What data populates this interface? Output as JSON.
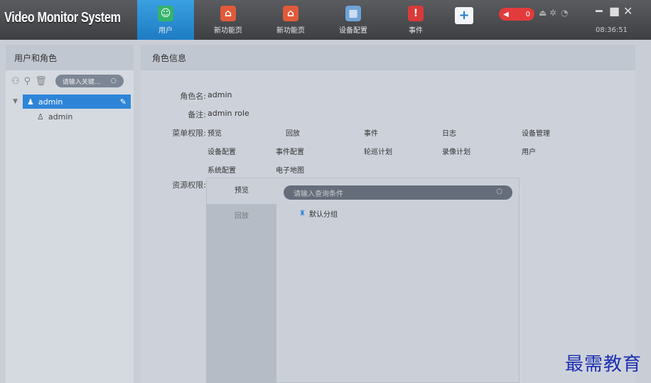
{
  "app": {
    "title": "Video Monitor System",
    "clock": "08:36:51"
  },
  "nav": {
    "tabs": [
      {
        "label": "用户",
        "active": true,
        "icon": "user-icon"
      },
      {
        "label": "新功能页",
        "active": false,
        "icon": "home-icon"
      },
      {
        "label": "新功能页",
        "active": false,
        "icon": "home-icon"
      },
      {
        "label": "设备配置",
        "active": false,
        "icon": "config-icon"
      },
      {
        "label": "事件",
        "active": false,
        "icon": "alarm-shield-icon"
      }
    ],
    "add_label": "+",
    "alarm_count": "0",
    "accent": "#1d7cc4"
  },
  "left": {
    "header": "用户和角色",
    "search_placeholder": "请输入关键...",
    "tree": {
      "root": "admin",
      "child": "admin"
    }
  },
  "main": {
    "header": "角色信息",
    "role_name_label": "角色名",
    "role_name": "admin",
    "remark_label": "备注",
    "remark": "admin role",
    "menu_perm_label": "菜单权限",
    "menu_perms": [
      [
        "预览",
        "回放",
        "事件",
        "日志",
        "设备管理"
      ],
      [
        "设备配置",
        "事件配置",
        "轮巡计划",
        "录像计划",
        "用户"
      ],
      [
        "系统配置",
        "电子地图"
      ]
    ],
    "resource_perm_label": "资源权限",
    "resource_tabs": [
      "预览",
      "回放"
    ],
    "resource_search_placeholder": "请输入查询条件",
    "group": "默认分组"
  },
  "watermark": "最需教育"
}
